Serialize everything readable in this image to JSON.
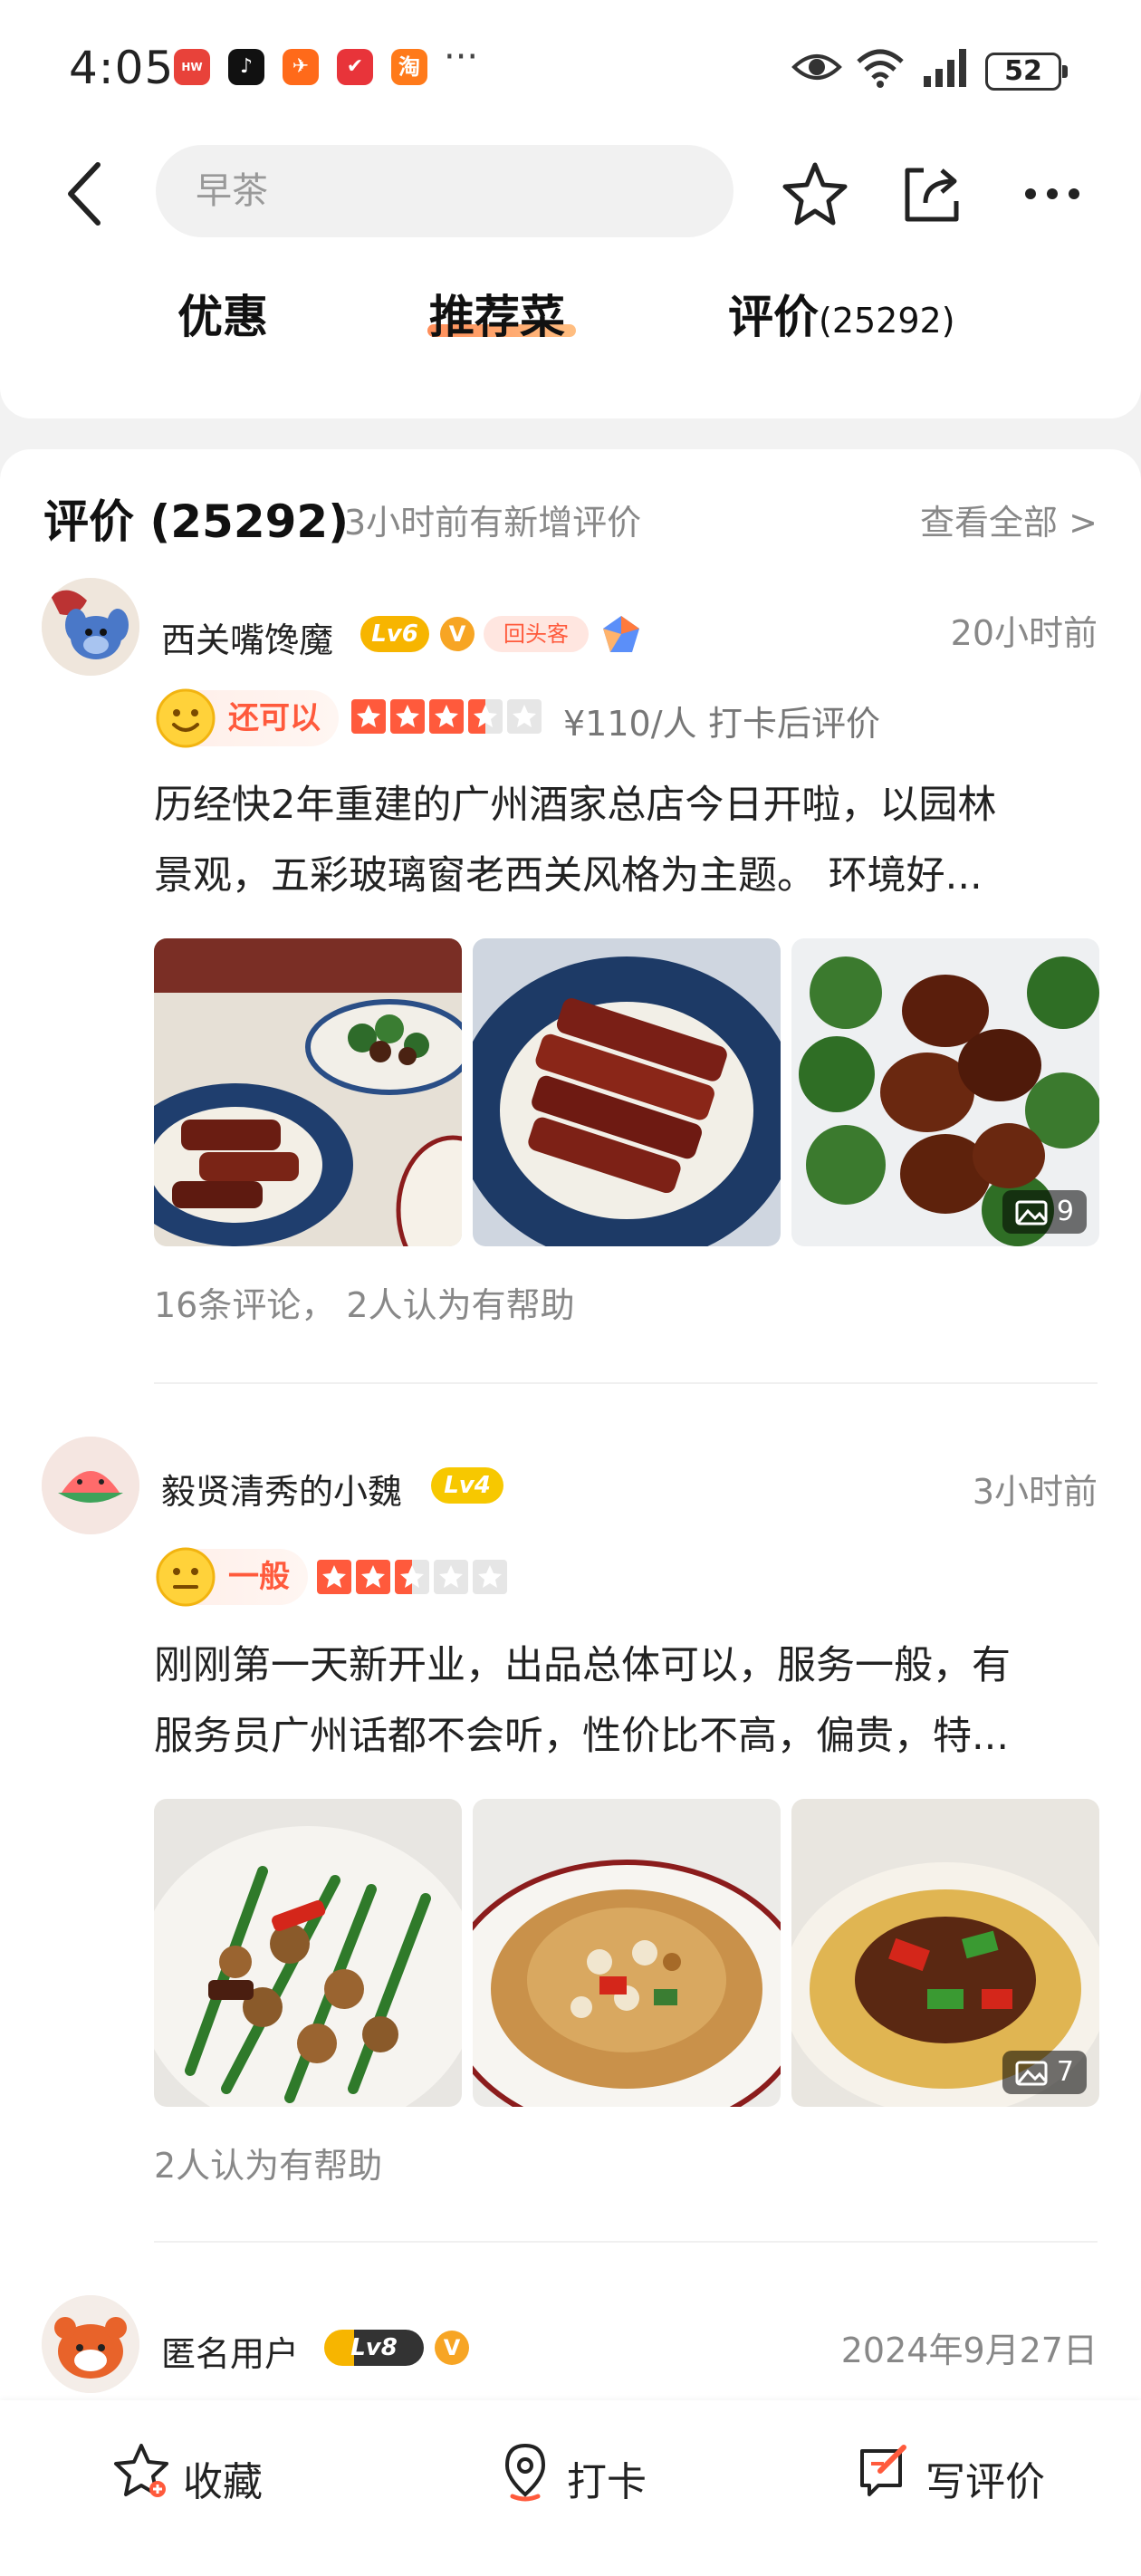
{
  "status_bar": {
    "time": "4:05",
    "battery": "52",
    "apps": [
      "huawei-store-icon",
      "douyin-icon",
      "feishu-icon",
      "xiaohongshu-icon",
      "taobao-icon"
    ]
  },
  "search": {
    "placeholder": "早茶"
  },
  "tabs": [
    {
      "label": "优惠"
    },
    {
      "label": "推荐菜",
      "active": true
    },
    {
      "label": "评价",
      "count": "(25292)"
    }
  ],
  "reviews_section": {
    "title": "评价 (25292)",
    "subtitle": "3小时前有新增评价",
    "view_all": "查看全部 >"
  },
  "reviews": [
    {
      "user": "西关嘴馋魔",
      "level": "Lv6",
      "verified": "V",
      "tag": "回头客",
      "time": "20小时前",
      "mood": "还可以",
      "rating": 3.5,
      "price": "¥110/人",
      "checkin": "打卡后评价",
      "text_line1": "历经快2年重建的广州酒家总店今日开啦，以园林",
      "text_line2": "景观，五彩玻璃窗老西关风格为主题。 环境好...",
      "photo_count": "9",
      "footer": "16条评论， 2人认为有帮助"
    },
    {
      "user": "毅贤清秀的小魏",
      "level": "Lv4",
      "time": "3小时前",
      "mood": "一般",
      "rating": 2.5,
      "text_line1": "刚刚第一天新开业，出品总体可以，服务一般，有",
      "text_line2": "服务员广州话都不会听，性价比不高，偏贵，特...",
      "photo_count": "7",
      "footer": "2人认为有帮助"
    },
    {
      "user": "匿名用户",
      "level": "Lv8",
      "verified": "V",
      "time": "2024年9月27日"
    }
  ],
  "bottom_bar": {
    "favorite": "收藏",
    "checkin": "打卡",
    "write_review": "写评价"
  },
  "colors": {
    "accent": "#ff5a3c",
    "star": "#ff5a3c",
    "level_gold": "#f7b500",
    "text_gray": "#888888"
  }
}
